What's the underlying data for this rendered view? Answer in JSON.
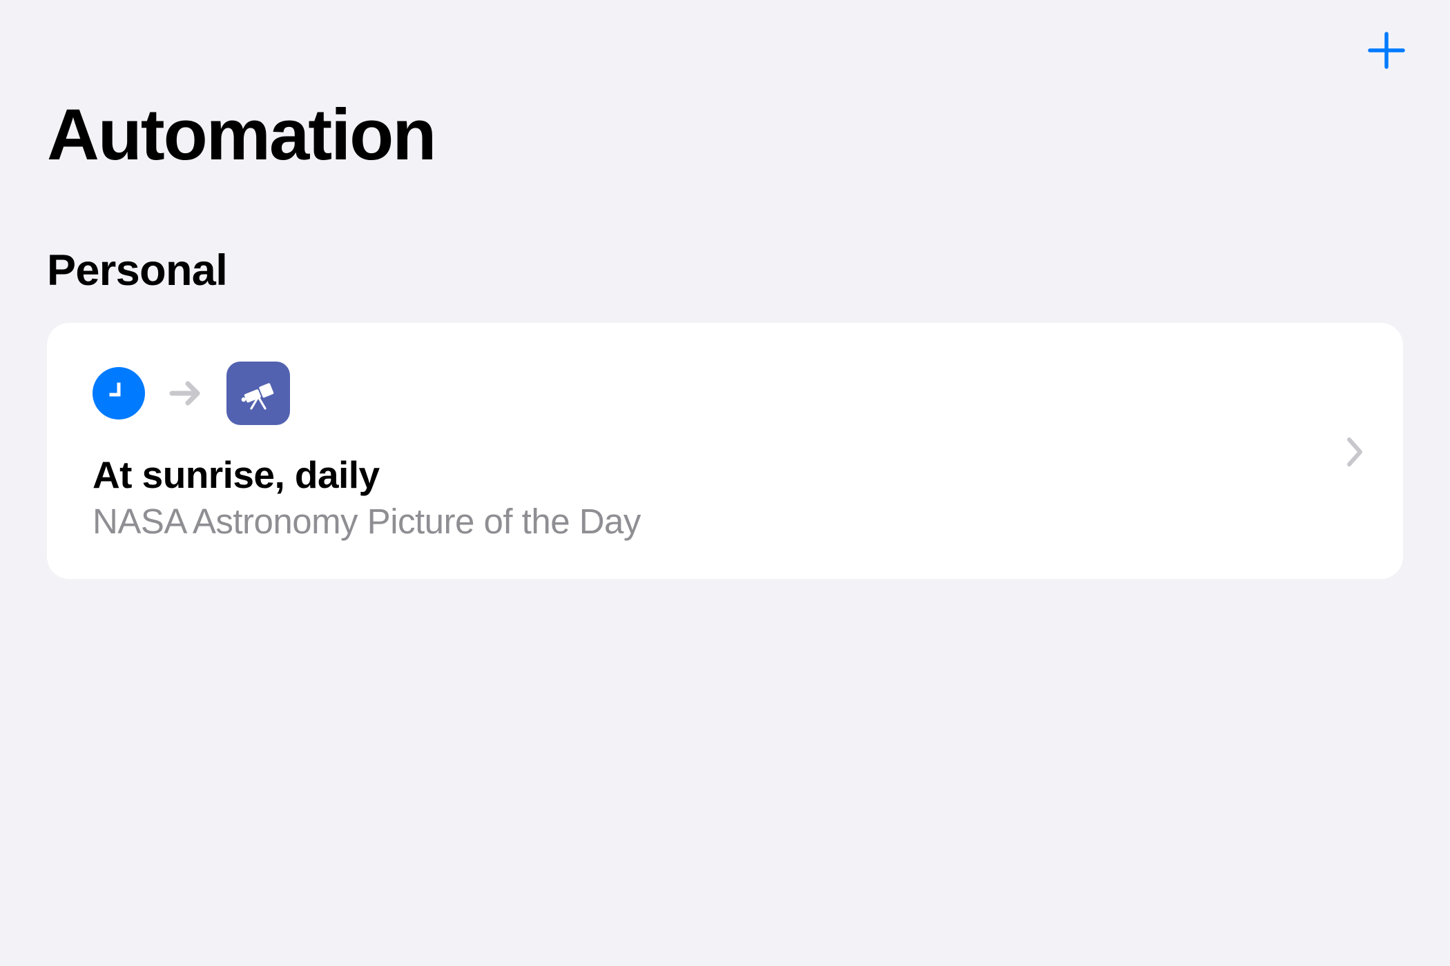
{
  "header": {
    "title": "Automation"
  },
  "sections": [
    {
      "title": "Personal",
      "automations": [
        {
          "trigger_icon": "clock-icon",
          "action_icon": "telescope-icon",
          "title": "At sunrise, daily",
          "subtitle": "NASA Astronomy Picture of the Day"
        }
      ]
    }
  ],
  "colors": {
    "accent": "#007aff",
    "action_bg": "#5262b0",
    "background": "#f2f2f7",
    "card_bg": "#ffffff",
    "text_primary": "#000000",
    "text_secondary": "#8e8e93",
    "chevron": "#c7c7cc"
  }
}
